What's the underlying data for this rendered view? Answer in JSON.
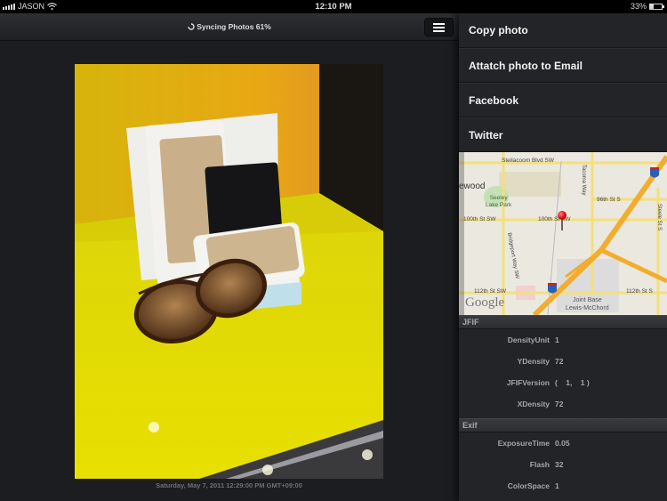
{
  "status_bar": {
    "carrier": "JASON",
    "time": "12:10 PM",
    "battery_text": "33%",
    "battery_level": 0.33,
    "icons": [
      "signal-icon",
      "wifi-icon",
      "battery-icon"
    ]
  },
  "viewer": {
    "sync_status": "Syncing Photos 61%",
    "sync_icon": "sync-icon",
    "menu_icon": "hamburger-menu-icon",
    "photo_description": "Wallets and sunglasses displayed on a yellow shelf",
    "photo_date": "Saturday, May 7, 2011 12:29:00 PM GMT+09:00"
  },
  "actions": [
    {
      "label": "Copy photo"
    },
    {
      "label": "Attatch photo to Email"
    },
    {
      "label": "Facebook"
    },
    {
      "label": "Twitter"
    }
  ],
  "map": {
    "provider": "Google",
    "labels": {
      "steilacoom": "Steilacoom Blvd SW",
      "tacoma": "Tacoma Way",
      "lakewood": "ewood",
      "seeley": "Seeley",
      "seeley2": "Lake Park",
      "st96": "96th St S",
      "st100a": "100th St SW",
      "st100b": "100th St SW",
      "bridgeport": "Bridgeport Way SW",
      "st112a": "112th St SW",
      "st112b": "112th St S",
      "jbase1": "Joint Base",
      "jbase2": "Lewis-McChord",
      "steele": "Steele St S",
      "i5": "5"
    },
    "pin_icon": "map-pin-icon"
  },
  "metadata": [
    {
      "section": "JFIF",
      "rows": [
        {
          "key": "DensityUnit",
          "value": "1"
        },
        {
          "key": "YDensity",
          "value": "72"
        },
        {
          "key": "JFIFVersion",
          "value": "(    1,    1 )"
        },
        {
          "key": "XDensity",
          "value": "72"
        }
      ]
    },
    {
      "section": "Exif",
      "rows": [
        {
          "key": "ExposureTime",
          "value": "0.05"
        },
        {
          "key": "Flash",
          "value": "32"
        },
        {
          "key": "ColorSpace",
          "value": "1"
        }
      ]
    }
  ]
}
